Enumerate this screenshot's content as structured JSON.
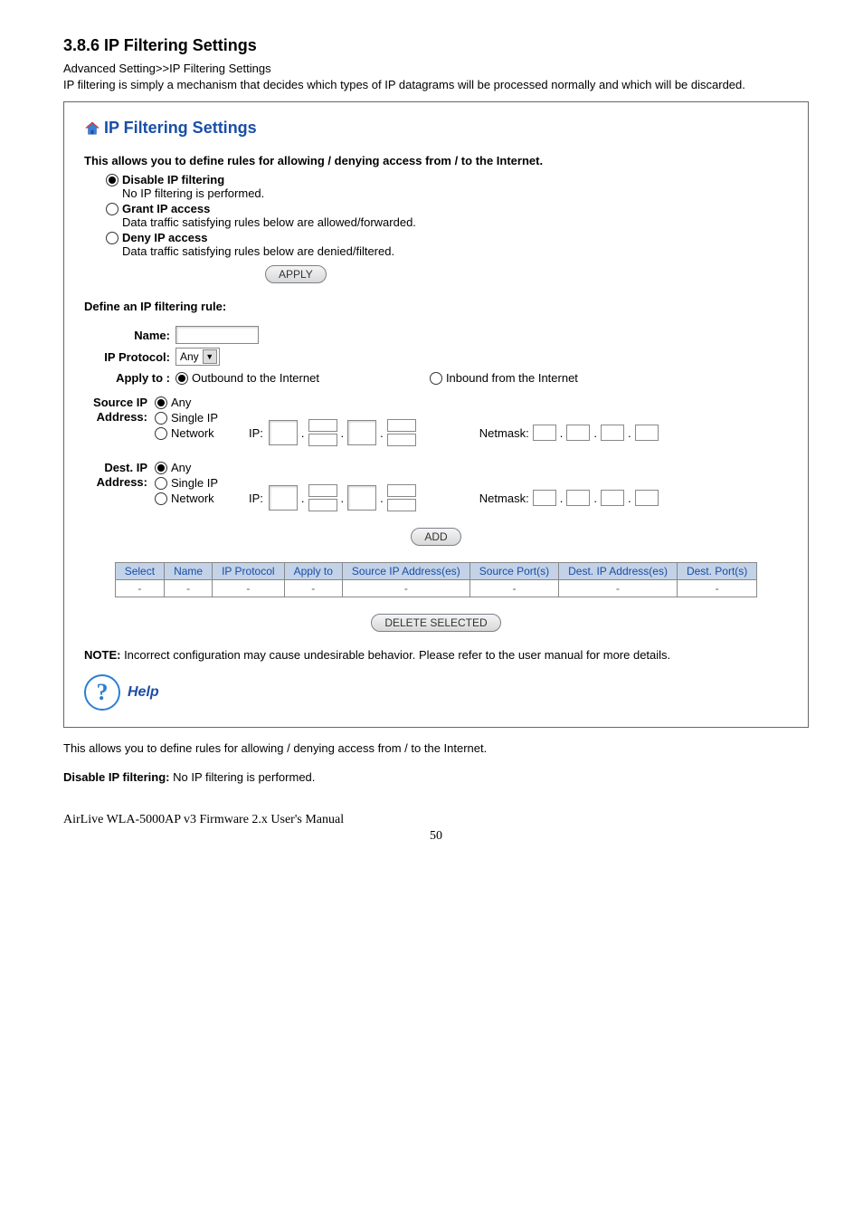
{
  "doc": {
    "section_heading": "3.8.6 IP Filtering Settings",
    "breadcrumb": "Advanced Setting>>IP Filtering Settings",
    "intro": "IP filtering is simply a mechanism that decides which types of IP datagrams will be processed normally and which will be discarded.",
    "post_allows": "This allows you to define rules for allowing / denying access from / to the Internet.",
    "disable_label": "Disable IP filtering:",
    "disable_desc": " No IP filtering is performed.",
    "footer_manual": "AirLive WLA-5000AP v3 Firmware 2.x User's Manual",
    "footer_page": "50"
  },
  "panel": {
    "title": "IP Filtering Settings",
    "intro": "This allows you to define rules for allowing / denying access from / to the Internet.",
    "mode_disable": "Disable IP filtering",
    "mode_disable_desc": "No IP filtering is performed.",
    "mode_grant": "Grant IP access",
    "mode_grant_desc": "Data traffic satisfying rules below are allowed/forwarded.",
    "mode_deny": "Deny IP access",
    "mode_deny_desc": "Data traffic satisfying rules below are denied/filtered.",
    "apply_btn": "APPLY",
    "define_heading": "Define an IP filtering rule:",
    "name_label": "Name:",
    "proto_label": "IP Protocol:",
    "proto_value": "Any",
    "applyto_label": "Apply to :",
    "applyto_out": "Outbound to the Internet",
    "applyto_in": "Inbound from the Internet",
    "src_label_l1": "Source IP",
    "src_label_l2": "Address:",
    "dst_label_l1": "Dest. IP",
    "dst_label_l2": "Address:",
    "opt_any": "Any",
    "opt_single": "Single IP",
    "opt_network": "Network",
    "ip_label": "IP:",
    "netmask_label": "Netmask:",
    "add_btn": "ADD",
    "delete_btn": "DELETE SELECTED",
    "table_headers": {
      "select": "Select",
      "name": "Name",
      "proto": "IP Protocol",
      "applyto": "Apply to",
      "srcaddr": "Source IP Address(es)",
      "srcport": "Source Port(s)",
      "dstaddr": "Dest. IP Address(es)",
      "dstport": "Dest. Port(s)"
    },
    "empty_cell": "-",
    "note_bold": "NOTE:",
    "note_text": " Incorrect configuration may cause undesirable behavior. Please refer to the user manual for more details.",
    "help": "Help"
  }
}
